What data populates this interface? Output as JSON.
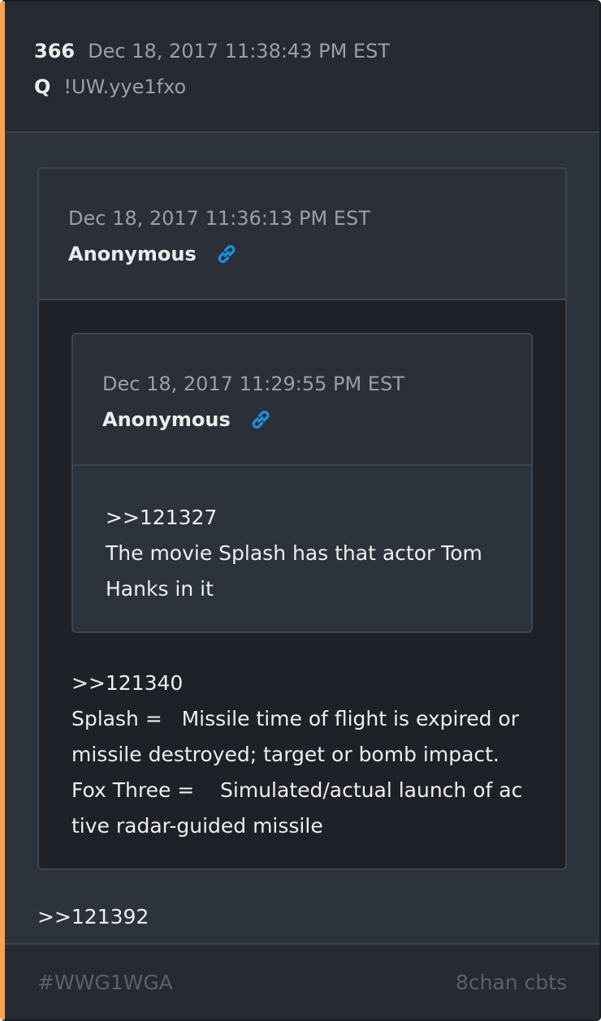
{
  "post": {
    "number": "366",
    "datetime": "Dec 18, 2017 11:38:43 PM EST",
    "author": "Q",
    "tripcode": "!UW.yye1fxo",
    "reply_ref": ">>121392"
  },
  "quote_outer": {
    "datetime": "Dec 18, 2017 11:36:13 PM EST",
    "author": "Anonymous",
    "message": [
      ">>121340",
      "Splash =   Missile time of flight is expired or",
      "missile destroyed; target or bomb impact.",
      "Fox Three =    Simulated/actual launch of ac",
      "tive radar-guided missile"
    ]
  },
  "quote_inner": {
    "datetime": "Dec 18, 2017 11:29:55 PM EST",
    "author": "Anonymous",
    "message": [
      ">>121327",
      "The movie Splash has that actor Tom",
      "Hanks in it"
    ]
  },
  "footer": {
    "hashtag": "#WWG1WGA",
    "source": "8chan cbts"
  },
  "colors": {
    "accent": "#f5a257",
    "link_icon": "#1e8fd6"
  }
}
